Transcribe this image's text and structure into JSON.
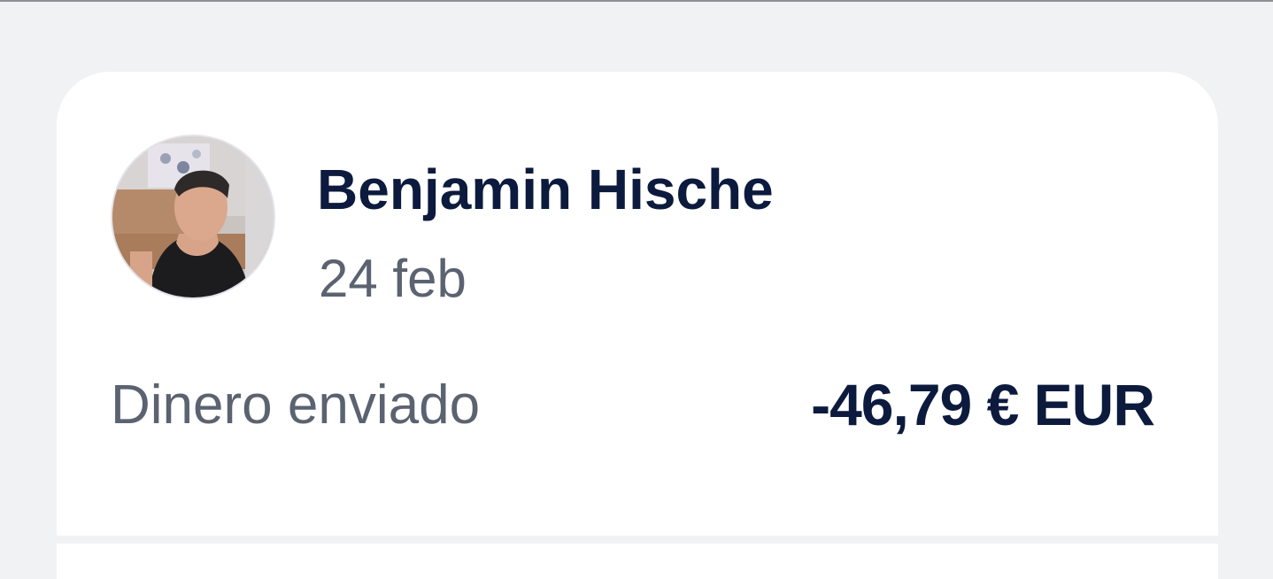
{
  "transaction": {
    "contact_name": "Benjamin Hische",
    "date": "24 feb",
    "type_label": "Dinero enviado",
    "amount": "-46,79 € EUR",
    "avatar_icon": "user-photo-avatar"
  },
  "colors": {
    "background": "#f1f2f4",
    "card": "#ffffff",
    "primary_text": "#0c1a3d",
    "secondary_text": "#5b6270"
  }
}
